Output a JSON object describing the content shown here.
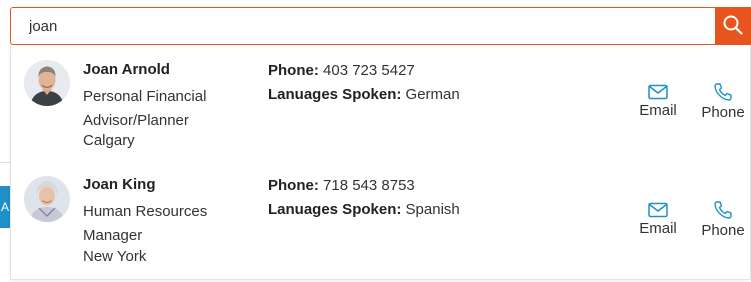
{
  "search": {
    "value": "joan",
    "button_icon": "search-icon"
  },
  "colors": {
    "accent": "#e8541e",
    "icon": "#1f8fc8"
  },
  "results": [
    {
      "name": "Joan Arnold",
      "role": "Personal Financial Advisor/Planner",
      "city": "Calgary",
      "phone_label": "Phone:",
      "phone": "403 723 5427",
      "languages_label": "Lanuages Spoken:",
      "languages": "German",
      "email_action": "Email",
      "phone_action": "Phone"
    },
    {
      "name": "Joan King",
      "role": "Human Resources Manager",
      "city": "New York",
      "phone_label": "Phone:",
      "phone": "718 543 8753",
      "languages_label": "Lanuages Spoken:",
      "languages": "Spanish",
      "email_action": "Email",
      "phone_action": "Phone"
    }
  ]
}
